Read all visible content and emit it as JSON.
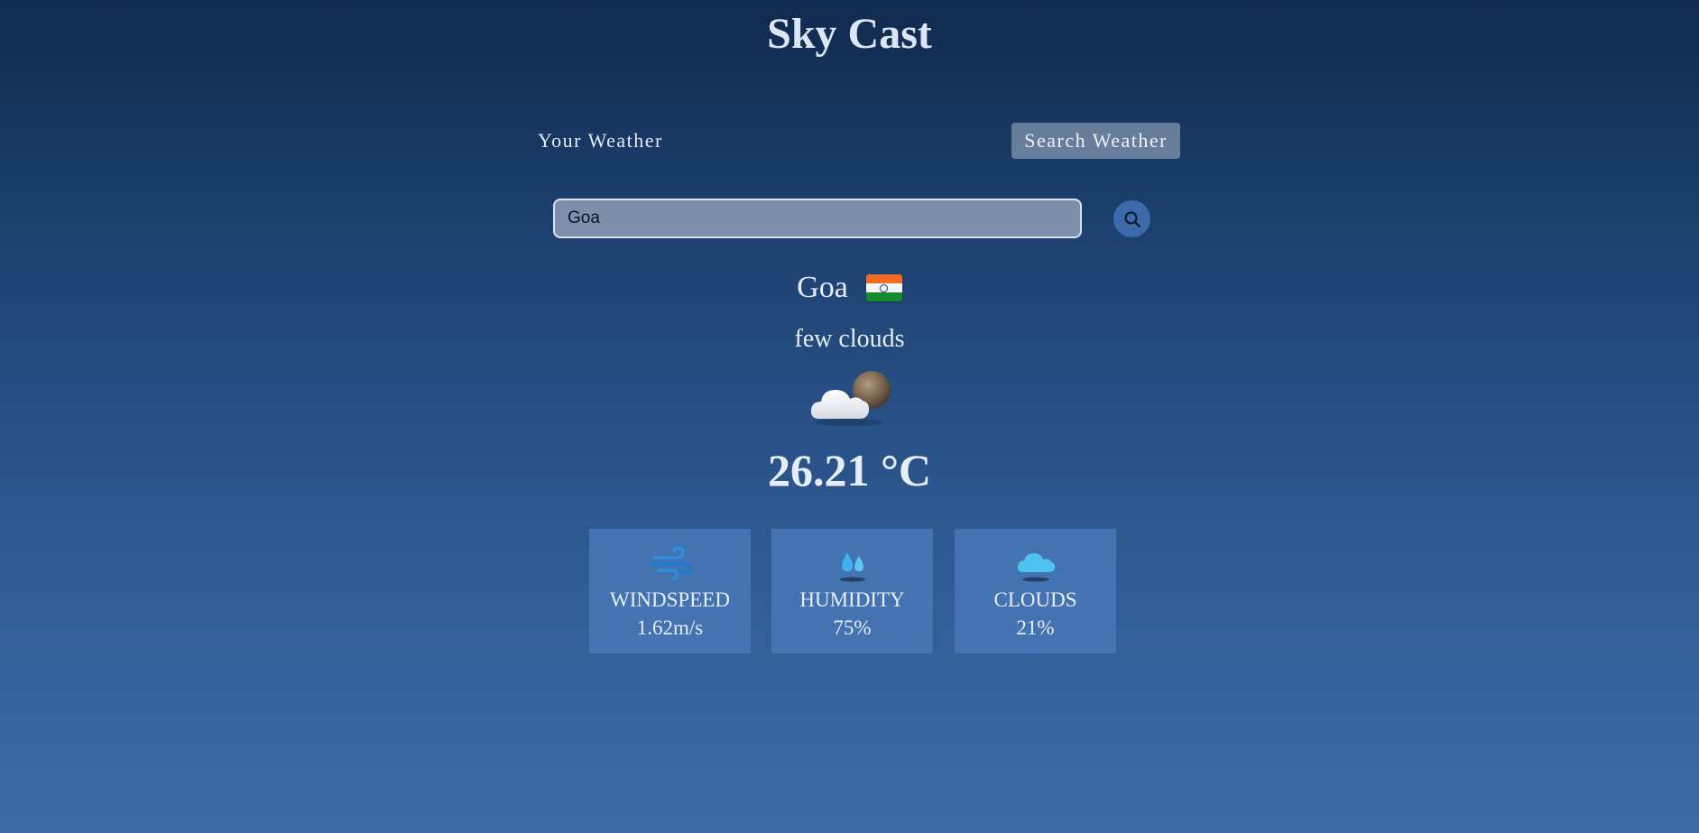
{
  "app": {
    "title": "Sky Cast"
  },
  "tabs": [
    {
      "label": "Your Weather",
      "active": false
    },
    {
      "label": "Search Weather",
      "active": true
    }
  ],
  "search": {
    "value": "Goa",
    "button_icon": "search-icon"
  },
  "location": {
    "city": "Goa",
    "flag_icon": "india-flag-icon"
  },
  "weather": {
    "description": "few clouds",
    "icon": "cloud-moon-icon",
    "temperature": "26.21 °C"
  },
  "stats": [
    {
      "icon": "wind-icon",
      "label": "WINDSPEED",
      "value": "1.62m/s"
    },
    {
      "icon": "humidity-drops-icon",
      "label": "HUMIDITY",
      "value": "75%"
    },
    {
      "icon": "cloud-icon",
      "label": "CLOUDS",
      "value": "21%"
    }
  ],
  "colors": {
    "background_top": "#112a4e",
    "background_bottom": "#3c6ca8",
    "card": "#4373b0",
    "search_button": "#3d6aac",
    "active_tab": "#a6b2c4"
  }
}
